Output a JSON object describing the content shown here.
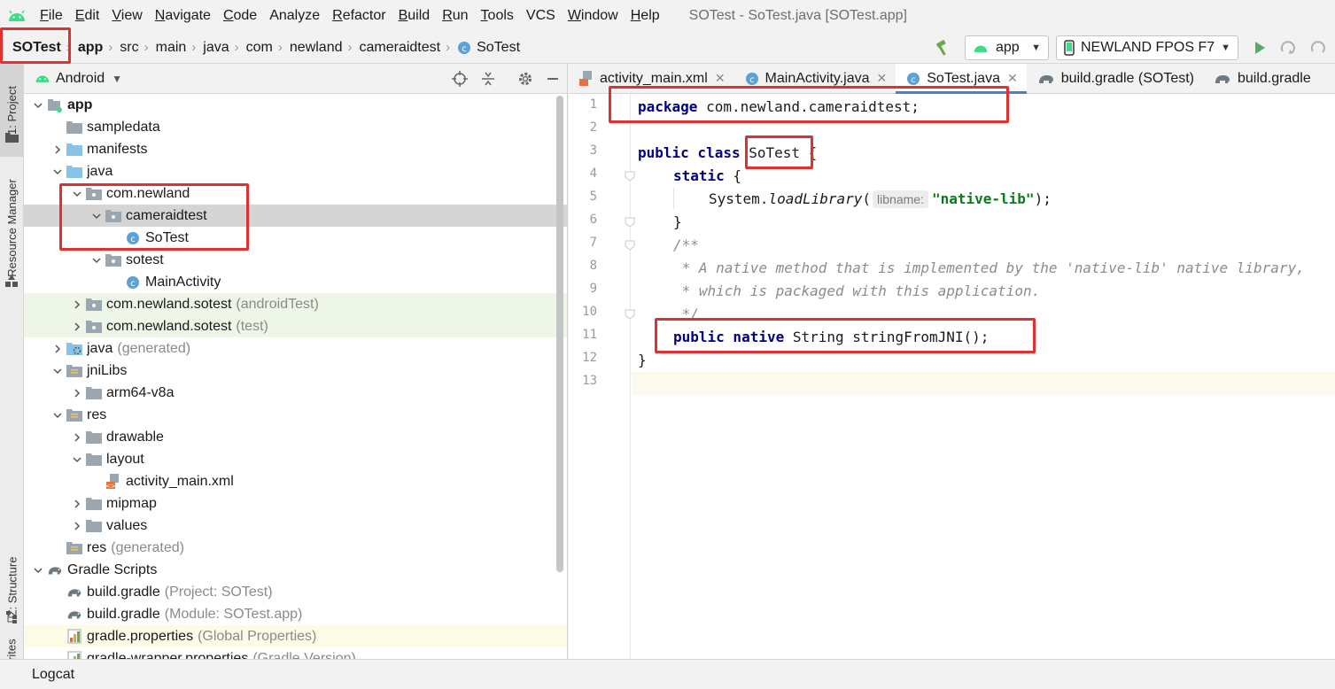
{
  "menubar": {
    "items": [
      {
        "label": "File",
        "mnemonic": "F",
        "rest": "ile"
      },
      {
        "label": "Edit",
        "mnemonic": "E",
        "rest": "dit"
      },
      {
        "label": "View",
        "mnemonic": "V",
        "rest": "iew"
      },
      {
        "label": "Navigate",
        "mnemonic": "N",
        "rest": "avigate"
      },
      {
        "label": "Code",
        "mnemonic": "C",
        "rest": "ode"
      },
      {
        "label": "Analyze",
        "mnemonic": "",
        "rest": "Analyze"
      },
      {
        "label": "Refactor",
        "mnemonic": "R",
        "rest": "efactor"
      },
      {
        "label": "Build",
        "mnemonic": "B",
        "rest": "uild"
      },
      {
        "label": "Run",
        "mnemonic": "R",
        "rest": "un"
      },
      {
        "label": "Tools",
        "mnemonic": "T",
        "rest": "ools"
      },
      {
        "label": "VCS",
        "mnemonic": "",
        "rest": "VCS"
      },
      {
        "label": "Window",
        "mnemonic": "W",
        "rest": "indow"
      },
      {
        "label": "Help",
        "mnemonic": "H",
        "rest": "elp"
      }
    ],
    "window_title": "SOTest - SoTest.java [SOTest.app]"
  },
  "navbar": {
    "breadcrumbs": [
      "SOTest",
      "app",
      "src",
      "main",
      "java",
      "com",
      "newland",
      "cameraidtest",
      "SoTest"
    ],
    "run_config": "app",
    "device": "NEWLAND FPOS F7"
  },
  "left_stripe": {
    "project_tab": "1: Project",
    "resource_manager_tab": "Resource Manager",
    "structure_tab": "Z: Structure",
    "favorites_tab": "vorites"
  },
  "project_panel": {
    "view_mode": "Android",
    "tree": [
      {
        "label": "app",
        "hint": "",
        "bold": true
      },
      {
        "label": "sampledata",
        "hint": ""
      },
      {
        "label": "manifests",
        "hint": ""
      },
      {
        "label": "java",
        "hint": ""
      },
      {
        "label": "com.newland",
        "hint": ""
      },
      {
        "label": "cameraidtest",
        "hint": ""
      },
      {
        "label": "SoTest",
        "hint": ""
      },
      {
        "label": "sotest",
        "hint": ""
      },
      {
        "label": "MainActivity",
        "hint": ""
      },
      {
        "label": "com.newland.sotest",
        "hint": "(androidTest)"
      },
      {
        "label": "com.newland.sotest",
        "hint": "(test)"
      },
      {
        "label": "java",
        "hint": "(generated)"
      },
      {
        "label": "jniLibs",
        "hint": ""
      },
      {
        "label": "arm64-v8a",
        "hint": ""
      },
      {
        "label": "res",
        "hint": ""
      },
      {
        "label": "drawable",
        "hint": ""
      },
      {
        "label": "layout",
        "hint": ""
      },
      {
        "label": "activity_main.xml",
        "hint": ""
      },
      {
        "label": "mipmap",
        "hint": ""
      },
      {
        "label": "values",
        "hint": ""
      },
      {
        "label": "res",
        "hint": "(generated)"
      },
      {
        "label": "Gradle Scripts",
        "hint": ""
      },
      {
        "label": "build.gradle",
        "hint": "(Project: SOTest)"
      },
      {
        "label": "build.gradle",
        "hint": "(Module: SOTest.app)"
      },
      {
        "label": "gradle.properties",
        "hint": "(Global Properties)"
      },
      {
        "label": "gradle-wrapper.properties",
        "hint": "(Gradle Version)"
      }
    ]
  },
  "editor": {
    "tabs": [
      {
        "label": "activity_main.xml",
        "closable": true
      },
      {
        "label": "MainActivity.java",
        "closable": true
      },
      {
        "label": "SoTest.java",
        "closable": true,
        "active": true
      },
      {
        "label": "build.gradle (SOTest)",
        "closable": false
      },
      {
        "label": "build.gradle",
        "closable": false
      }
    ],
    "line_numbers": [
      "1",
      "2",
      "3",
      "4",
      "5",
      "6",
      "7",
      "8",
      "9",
      "10",
      "11",
      "12",
      "13"
    ],
    "code": {
      "l1_kw": "package",
      "l1_rest": " com.newland.cameraidtest;",
      "l3_kw": "public class",
      "l3_name": "SoTest",
      "l3_rest": " {",
      "l4_kw": "static",
      "l4_rest": " {",
      "l5_pre": "System.",
      "l5_call": "loadLibrary",
      "l5_paren": "(",
      "l5_hint": "libname:",
      "l5_str": "\"native-lib\"",
      "l5_end": ");",
      "l6": "}",
      "l7": "/**",
      "l8": " * A native method that is implemented by the 'native-lib' native library,",
      "l9": " * which is packaged with this application.",
      "l10": " */",
      "l11_kw": "public native",
      "l11_rest": " String stringFromJNI();",
      "l12": "}"
    }
  },
  "bottombar": {
    "logcat": "Logcat"
  },
  "colors": {
    "highlight_box": "#e03030",
    "keyword": "#000080",
    "string": "#067d17",
    "comment": "#8c8c8c",
    "android_green": "#3ddc84",
    "active_tab_underline": "#4083c9"
  }
}
